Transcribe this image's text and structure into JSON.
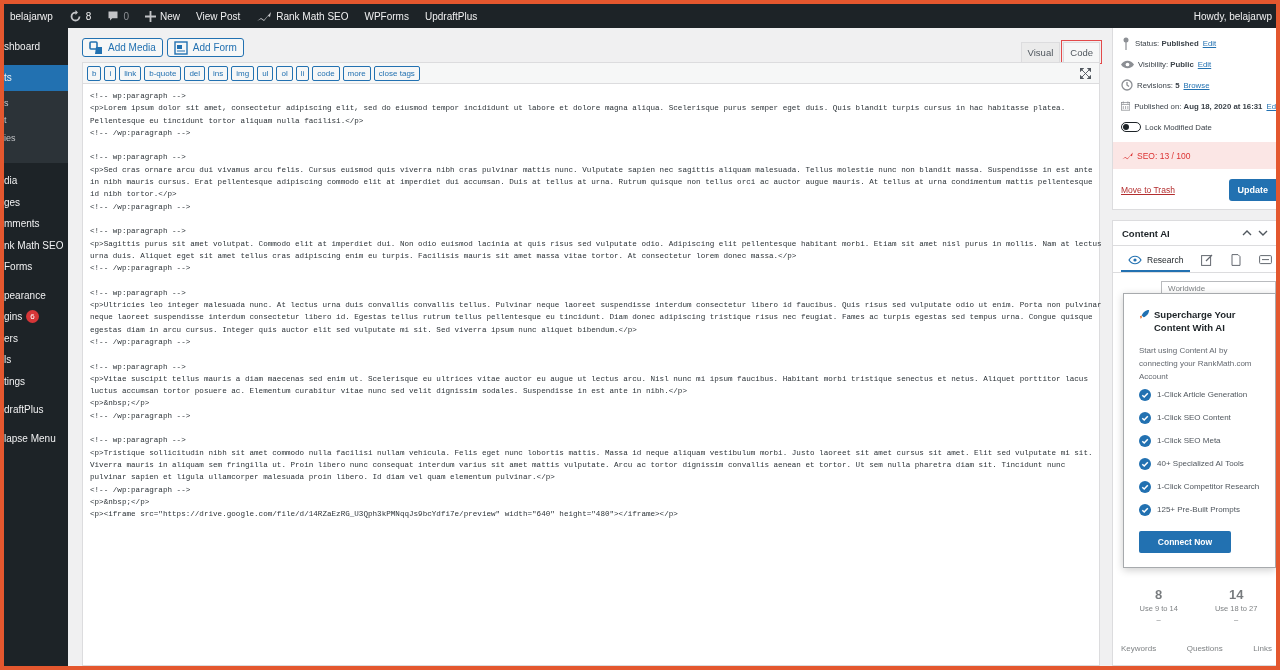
{
  "admin_bar": {
    "items": [
      {
        "kind": "site",
        "label": "belajarwp"
      },
      {
        "kind": "updates",
        "label": "8"
      },
      {
        "kind": "comments",
        "label": "0"
      },
      {
        "kind": "new",
        "label": "New"
      },
      {
        "kind": "text",
        "label": "View Post"
      },
      {
        "kind": "rankmath",
        "label": "Rank Math SEO"
      },
      {
        "kind": "text",
        "label": "WPForms"
      },
      {
        "kind": "text",
        "label": "UpdraftPlus"
      }
    ],
    "greeting": "Howdy, belajarwp"
  },
  "sidebar": {
    "sections": [
      [
        {
          "label": "shboard",
          "selected": false
        }
      ],
      [
        {
          "label": "ts",
          "selected": true,
          "children": [
            {
              "label": "s"
            },
            {
              "label": "t"
            },
            {
              "label": "ies"
            }
          ]
        }
      ],
      [
        {
          "label": "dia",
          "selected": false
        },
        {
          "label": "ges",
          "selected": false
        },
        {
          "label": "mments",
          "selected": false
        },
        {
          "label": "nk Math SEO",
          "selected": false
        },
        {
          "label": "Forms",
          "selected": false
        }
      ],
      [
        {
          "label": "pearance",
          "selected": false
        },
        {
          "label": "gins",
          "selected": false,
          "badge": "6"
        },
        {
          "label": "ers",
          "selected": false
        },
        {
          "label": "ls",
          "selected": false
        },
        {
          "label": "tings",
          "selected": false
        }
      ],
      [
        {
          "label": "draftPlus",
          "selected": false
        }
      ],
      [
        {
          "label": "lapse Menu",
          "selected": false
        }
      ]
    ]
  },
  "editor": {
    "media_buttons": [
      {
        "kind": "media",
        "label": "Add Media"
      },
      {
        "kind": "form",
        "label": "Add Form"
      }
    ],
    "tabs": [
      {
        "label": "Visual",
        "selected": false
      },
      {
        "label": "Code",
        "selected": true
      }
    ],
    "quicktags": [
      "b",
      "i",
      "link",
      "b-quote",
      "del",
      "ins",
      "img",
      "ul",
      "ol",
      "li",
      "code",
      "more",
      "close tags"
    ],
    "blocks": [
      [
        "<!-- wp:paragraph -->",
        "<p>Lorem ipsum dolor sit amet, consectetur adipiscing elit, sed do eiusmod tempor incididunt ut labore et dolore magna aliqua. Scelerisque purus semper eget duis. Quis blandit turpis cursus in hac habitasse platea.",
        "Pellentesque eu tincidunt tortor aliquam nulla facilisi.</p>",
        "<!-- /wp:paragraph -->"
      ],
      [
        "<!-- wp:paragraph -->",
        "<p>Sed cras ornare arcu dui vivamus arcu felis. Cursus euismod quis viverra nibh cras pulvinar mattis nunc. Vulputate sapien nec sagittis aliquam malesuada. Tellus molestie nunc non blandit massa. Suspendisse in est ante",
        "in nibh mauris cursus. Erat pellentesque adipiscing commodo elit at imperdiet dui accumsan. Duis at tellus at urna. Rutrum quisque non tellus orci ac auctor augue mauris. At tellus at urna condimentum mattis pellentesque",
        "id nibh tortor.</p>",
        "<!-- /wp:paragraph -->"
      ],
      [
        "<!-- wp:paragraph -->",
        "<p>Sagittis purus sit amet volutpat. Commodo elit at imperdiet dui. Non odio euismod lacinia at quis risus sed vulputate odio. Adipiscing elit pellentesque habitant morbi. Etiam sit amet nisl purus in mollis. Nam at lectus",
        "urna duis. Aliquet eget sit amet tellus cras adipiscing enim eu turpis. Facilisis mauris sit amet massa vitae tortor. At consectetur lorem donec massa.</p>",
        "<!-- /wp:paragraph -->"
      ],
      [
        "<!-- wp:paragraph -->",
        "<p>Ultricies leo integer malesuada nunc. At lectus urna duis convallis convallis tellus. Pulvinar neque laoreet suspendisse interdum consectetur libero id faucibus. Quis risus sed vulputate odio ut enim. Porta non pulvinar",
        "neque laoreet suspendisse interdum consectetur libero id. Egestas tellus rutrum tellus pellentesque eu tincidunt. Diam donec adipiscing tristique risus nec feugiat. Fames ac turpis egestas sed tempus urna. Congue quisque",
        "egestas diam in arcu cursus. Integer quis auctor elit sed vulputate mi sit. Sed viverra ipsum nunc aliquet bibendum.</p>",
        "<!-- /wp:paragraph -->"
      ],
      [
        "<!-- wp:paragraph -->",
        "<p>Vitae suscipit tellus mauris a diam maecenas sed enim ut. Scelerisque eu ultrices vitae auctor eu augue ut lectus arcu. Nisl nunc mi ipsum faucibus. Habitant morbi tristique senectus et netus. Aliquet porttitor lacus",
        "luctus accumsan tortor posuere ac. Elementum curabitur vitae nunc sed velit dignissim sodales. Suspendisse in est ante in nibh.</p>",
        "<p>&nbsp;</p>",
        "<!-- /wp:paragraph -->"
      ],
      [
        "<!-- wp:paragraph -->",
        "<p>Tristique sollicitudin nibh sit amet commodo nulla facilisi nullam vehicula. Felis eget nunc lobortis mattis. Massa id neque aliquam vestibulum morbi. Justo laoreet sit amet cursus sit amet. Elit sed vulputate mi sit.",
        "Viverra mauris in aliquam sem fringilla ut. Proin libero nunc consequat interdum varius sit amet mattis vulputate. Arcu ac tortor dignissim convallis aenean et tortor. Ut sem nulla pharetra diam sit. Tincidunt nunc",
        "pulvinar sapien et ligula ullamcorper malesuada proin libero. Id diam vel quam elementum pulvinar.</p>",
        "<!-- /wp:paragraph -->",
        "<p>&nbsp;</p>",
        "<p><iframe src=\"https://drive.google.com/file/d/14RZaEzRG_U3Qph3kPMNqqJs9bcYdfi7e/preview\" width=\"640\" height=\"480\"></iframe></p>"
      ]
    ]
  },
  "publish": {
    "rows": [
      {
        "kind": "status",
        "label": "Status:",
        "value": "Published",
        "link": "Edit"
      },
      {
        "kind": "visibility",
        "label": "Visibility:",
        "value": "Public",
        "link": "Edit"
      },
      {
        "kind": "revisions",
        "label": "Revisions:",
        "value": "5",
        "link": "Browse"
      },
      {
        "kind": "date",
        "label": "Published on:",
        "value": "Aug 18, 2020 at 16:31",
        "link": "Ed"
      }
    ],
    "lock_toggle": {
      "label": "Lock Modified Date",
      "on": false
    },
    "seo_score": "SEO: 13 / 100",
    "trash_link": "Move to Trash",
    "update_button": "Update"
  },
  "content_ai": {
    "title": "Content AI",
    "tabs": [
      {
        "kind": "research",
        "label": "Research",
        "selected": true
      },
      {
        "kind": "edit",
        "selected": false
      },
      {
        "kind": "copy",
        "selected": false
      },
      {
        "kind": "chat",
        "selected": false
      }
    ],
    "country_select": "Worldwide",
    "stats": [
      {
        "value": "8",
        "hint": "Use 9 to 14",
        "dash": "–"
      },
      {
        "value": "14",
        "hint": "Use 18 to 27",
        "dash": "–"
      }
    ],
    "bottom_tabs": [
      "Keywords",
      "Questions",
      "Links"
    ],
    "popup": {
      "title": "Supercharge Your Content With AI",
      "text": "Start using Content AI by connecting your RankMath.com Account",
      "features": [
        "1-Click Article Generation",
        "1-Click SEO Content",
        "1-Click SEO Meta",
        "40+ Specialized AI Tools",
        "1-Click Competitor Research",
        "125+ Pre-Built Prompts"
      ],
      "button": "Connect Now"
    }
  }
}
